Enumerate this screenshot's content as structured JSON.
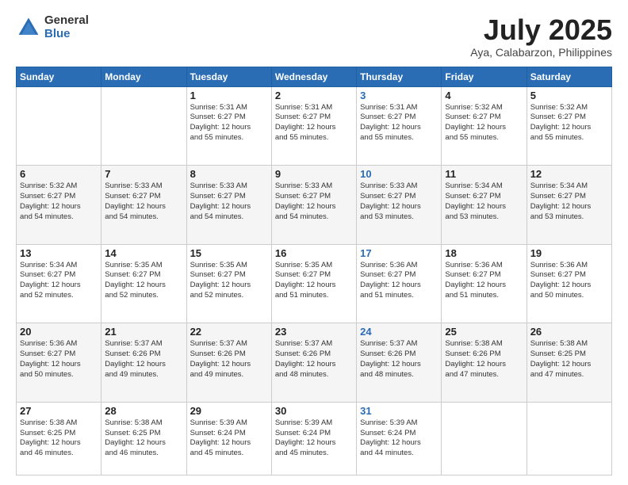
{
  "header": {
    "logo_general": "General",
    "logo_blue": "Blue",
    "month": "July 2025",
    "location": "Aya, Calabarzon, Philippines"
  },
  "weekdays": [
    "Sunday",
    "Monday",
    "Tuesday",
    "Wednesday",
    "Thursday",
    "Friday",
    "Saturday"
  ],
  "rows": [
    [
      {
        "day": "",
        "content": ""
      },
      {
        "day": "",
        "content": ""
      },
      {
        "day": "1",
        "content": "Sunrise: 5:31 AM\nSunset: 6:27 PM\nDaylight: 12 hours\nand 55 minutes."
      },
      {
        "day": "2",
        "content": "Sunrise: 5:31 AM\nSunset: 6:27 PM\nDaylight: 12 hours\nand 55 minutes."
      },
      {
        "day": "3",
        "content": "Sunrise: 5:31 AM\nSunset: 6:27 PM\nDaylight: 12 hours\nand 55 minutes."
      },
      {
        "day": "4",
        "content": "Sunrise: 5:32 AM\nSunset: 6:27 PM\nDaylight: 12 hours\nand 55 minutes."
      },
      {
        "day": "5",
        "content": "Sunrise: 5:32 AM\nSunset: 6:27 PM\nDaylight: 12 hours\nand 55 minutes."
      }
    ],
    [
      {
        "day": "6",
        "content": "Sunrise: 5:32 AM\nSunset: 6:27 PM\nDaylight: 12 hours\nand 54 minutes."
      },
      {
        "day": "7",
        "content": "Sunrise: 5:33 AM\nSunset: 6:27 PM\nDaylight: 12 hours\nand 54 minutes."
      },
      {
        "day": "8",
        "content": "Sunrise: 5:33 AM\nSunset: 6:27 PM\nDaylight: 12 hours\nand 54 minutes."
      },
      {
        "day": "9",
        "content": "Sunrise: 5:33 AM\nSunset: 6:27 PM\nDaylight: 12 hours\nand 54 minutes."
      },
      {
        "day": "10",
        "content": "Sunrise: 5:33 AM\nSunset: 6:27 PM\nDaylight: 12 hours\nand 53 minutes."
      },
      {
        "day": "11",
        "content": "Sunrise: 5:34 AM\nSunset: 6:27 PM\nDaylight: 12 hours\nand 53 minutes."
      },
      {
        "day": "12",
        "content": "Sunrise: 5:34 AM\nSunset: 6:27 PM\nDaylight: 12 hours\nand 53 minutes."
      }
    ],
    [
      {
        "day": "13",
        "content": "Sunrise: 5:34 AM\nSunset: 6:27 PM\nDaylight: 12 hours\nand 52 minutes."
      },
      {
        "day": "14",
        "content": "Sunrise: 5:35 AM\nSunset: 6:27 PM\nDaylight: 12 hours\nand 52 minutes."
      },
      {
        "day": "15",
        "content": "Sunrise: 5:35 AM\nSunset: 6:27 PM\nDaylight: 12 hours\nand 52 minutes."
      },
      {
        "day": "16",
        "content": "Sunrise: 5:35 AM\nSunset: 6:27 PM\nDaylight: 12 hours\nand 51 minutes."
      },
      {
        "day": "17",
        "content": "Sunrise: 5:36 AM\nSunset: 6:27 PM\nDaylight: 12 hours\nand 51 minutes."
      },
      {
        "day": "18",
        "content": "Sunrise: 5:36 AM\nSunset: 6:27 PM\nDaylight: 12 hours\nand 51 minutes."
      },
      {
        "day": "19",
        "content": "Sunrise: 5:36 AM\nSunset: 6:27 PM\nDaylight: 12 hours\nand 50 minutes."
      }
    ],
    [
      {
        "day": "20",
        "content": "Sunrise: 5:36 AM\nSunset: 6:27 PM\nDaylight: 12 hours\nand 50 minutes."
      },
      {
        "day": "21",
        "content": "Sunrise: 5:37 AM\nSunset: 6:26 PM\nDaylight: 12 hours\nand 49 minutes."
      },
      {
        "day": "22",
        "content": "Sunrise: 5:37 AM\nSunset: 6:26 PM\nDaylight: 12 hours\nand 49 minutes."
      },
      {
        "day": "23",
        "content": "Sunrise: 5:37 AM\nSunset: 6:26 PM\nDaylight: 12 hours\nand 48 minutes."
      },
      {
        "day": "24",
        "content": "Sunrise: 5:37 AM\nSunset: 6:26 PM\nDaylight: 12 hours\nand 48 minutes."
      },
      {
        "day": "25",
        "content": "Sunrise: 5:38 AM\nSunset: 6:26 PM\nDaylight: 12 hours\nand 47 minutes."
      },
      {
        "day": "26",
        "content": "Sunrise: 5:38 AM\nSunset: 6:25 PM\nDaylight: 12 hours\nand 47 minutes."
      }
    ],
    [
      {
        "day": "27",
        "content": "Sunrise: 5:38 AM\nSunset: 6:25 PM\nDaylight: 12 hours\nand 46 minutes."
      },
      {
        "day": "28",
        "content": "Sunrise: 5:38 AM\nSunset: 6:25 PM\nDaylight: 12 hours\nand 46 minutes."
      },
      {
        "day": "29",
        "content": "Sunrise: 5:39 AM\nSunset: 6:24 PM\nDaylight: 12 hours\nand 45 minutes."
      },
      {
        "day": "30",
        "content": "Sunrise: 5:39 AM\nSunset: 6:24 PM\nDaylight: 12 hours\nand 45 minutes."
      },
      {
        "day": "31",
        "content": "Sunrise: 5:39 AM\nSunset: 6:24 PM\nDaylight: 12 hours\nand 44 minutes."
      },
      {
        "day": "",
        "content": ""
      },
      {
        "day": "",
        "content": ""
      }
    ]
  ]
}
